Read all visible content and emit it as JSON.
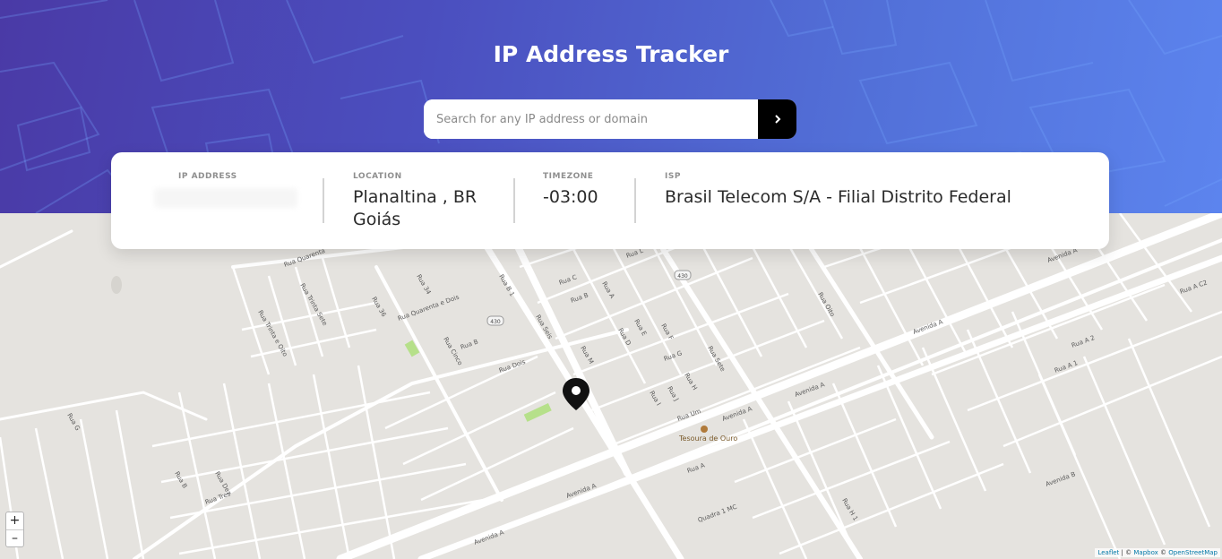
{
  "header": {
    "title": "IP Address Tracker",
    "gradient_start": "#4a3aa6",
    "gradient_end": "#5c84ee"
  },
  "search": {
    "placeholder": "Search for any IP address or domain",
    "value": "",
    "button_icon": "chevron-right-icon"
  },
  "info": {
    "ip_label": "IP ADDRESS",
    "ip_value": "",
    "location_label": "LOCATION",
    "location_line1": "Planaltina , BR",
    "location_line2": "Goiás",
    "timezone_label": "TIMEZONE",
    "timezone_value": "-03:00",
    "isp_label": "ISP",
    "isp_value": "Brasil Telecom S/A - Filial Distrito Federal"
  },
  "map": {
    "zoom_in": "+",
    "zoom_out": "–",
    "attribution": {
      "leaflet": "Leaflet",
      "sep1": " | © ",
      "mapbox": "Mapbox",
      "sep2": " © ",
      "osm": "OpenStreetMap"
    },
    "marker_icon": "location-pin-icon",
    "poi": "Tesoura de Ouro",
    "shield_labels": [
      "430",
      "430"
    ],
    "street_labels": [
      "Rua Quarenta",
      "Rua Trinta e Oito",
      "Rua Trinta Sete",
      "Rua 36",
      "Rua 34",
      "Rua Quarenta e Dois",
      "Rua Cinco",
      "Rua B",
      "Rua Dois",
      "Rua Seis",
      "Rua B 1",
      "Rua C",
      "Rua B",
      "Rua A",
      "Rua M",
      "Rua L",
      "Rua D",
      "Rua E",
      "Rua F",
      "Rua G",
      "Rua H",
      "Rua I",
      "Rua J",
      "Rua Sete",
      "Rua Oito",
      "Rua Um",
      "Avenida A",
      "Avenida A",
      "Rua G",
      "Rua B",
      "Rua Tres",
      "Rua A",
      "Rua C 2",
      "Avenida B",
      "Quadra 1 MC",
      "Rua H 1",
      "Rua Dez",
      "Rua A 2",
      "Rua A 1",
      "Rua A C2"
    ]
  }
}
